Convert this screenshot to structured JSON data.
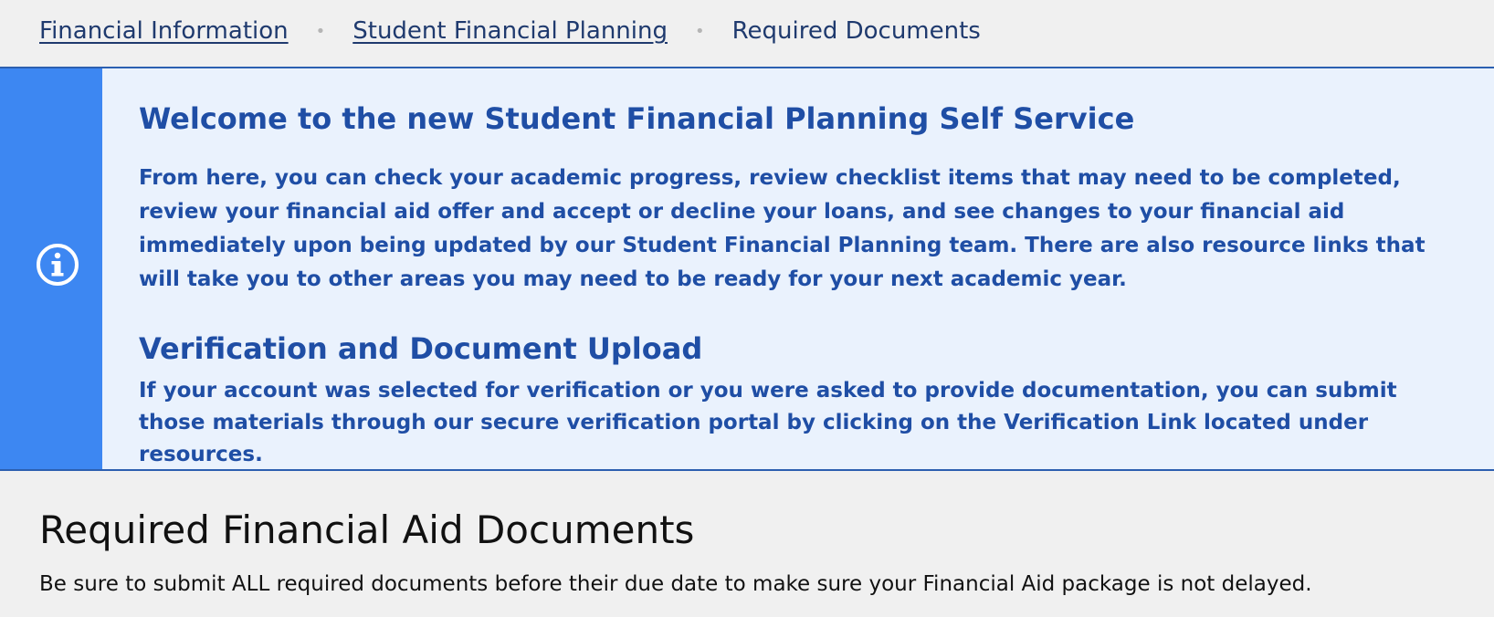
{
  "breadcrumb": {
    "items": [
      {
        "label": "Financial Information"
      },
      {
        "label": "Student Financial Planning"
      }
    ],
    "current": "Required Documents",
    "separator": "•"
  },
  "banner": {
    "icon": "info-icon",
    "title": "Welcome to the new Student Financial Planning Self Service",
    "paragraph": "From here, you can check your academic progress, review checklist items that may need to be completed, review your financial aid offer and accept or decline your loans, and see changes to your financial aid immediately upon being updated by our Student Financial Planning team.  There are also resource links that will take you to other areas you may need to be ready for your next academic year.",
    "subtitle": "Verification and Document Upload",
    "paragraph2": "If your account was selected for verification or you were asked to provide documentation, you can submit those materials through our secure verification portal by clicking on the Verification Link located under resources.",
    "colors": {
      "stripe": "#3d87f2",
      "background": "#eaf2fd",
      "text": "#1f4ea5"
    }
  },
  "section": {
    "title": "Required Financial Aid Documents",
    "description": "Be sure to submit ALL required documents before their due date to make sure your Financial Aid package is not delayed."
  }
}
